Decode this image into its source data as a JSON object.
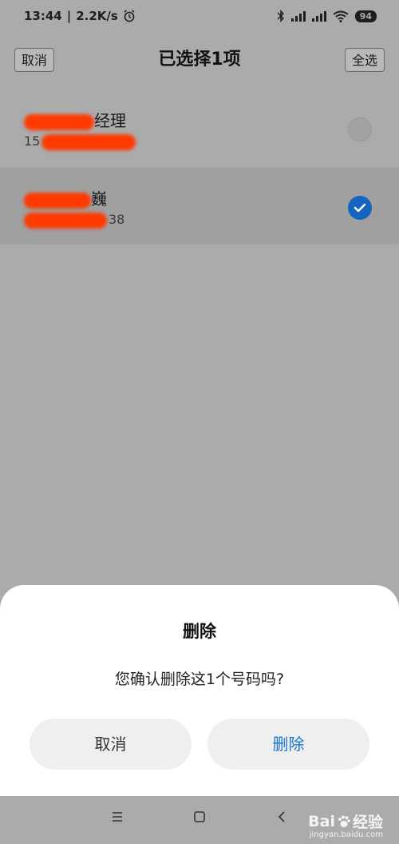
{
  "status_bar": {
    "time": "13:44",
    "speed": "2.2K/s",
    "battery": "94"
  },
  "header": {
    "cancel_label": "取消",
    "title": "已选择1项",
    "select_all_label": "全选"
  },
  "contacts": [
    {
      "name_visible": "经理",
      "phone_visible": "15",
      "selected": false
    },
    {
      "name_visible": "巍",
      "phone_visible": "38",
      "selected": true
    }
  ],
  "dialog": {
    "title": "删除",
    "message": "您确认删除这1个号码吗?",
    "cancel_label": "取消",
    "delete_label": "删除"
  },
  "colors": {
    "accent": "#1565c0",
    "delete_text": "#1a73c8",
    "redaction": "#ff3a00"
  },
  "nav_icons": [
    "menu-icon",
    "home-icon",
    "back-icon"
  ],
  "watermark": {
    "brand": "Bai",
    "brand2": "经验",
    "url": "jingyan.baidu.com"
  }
}
